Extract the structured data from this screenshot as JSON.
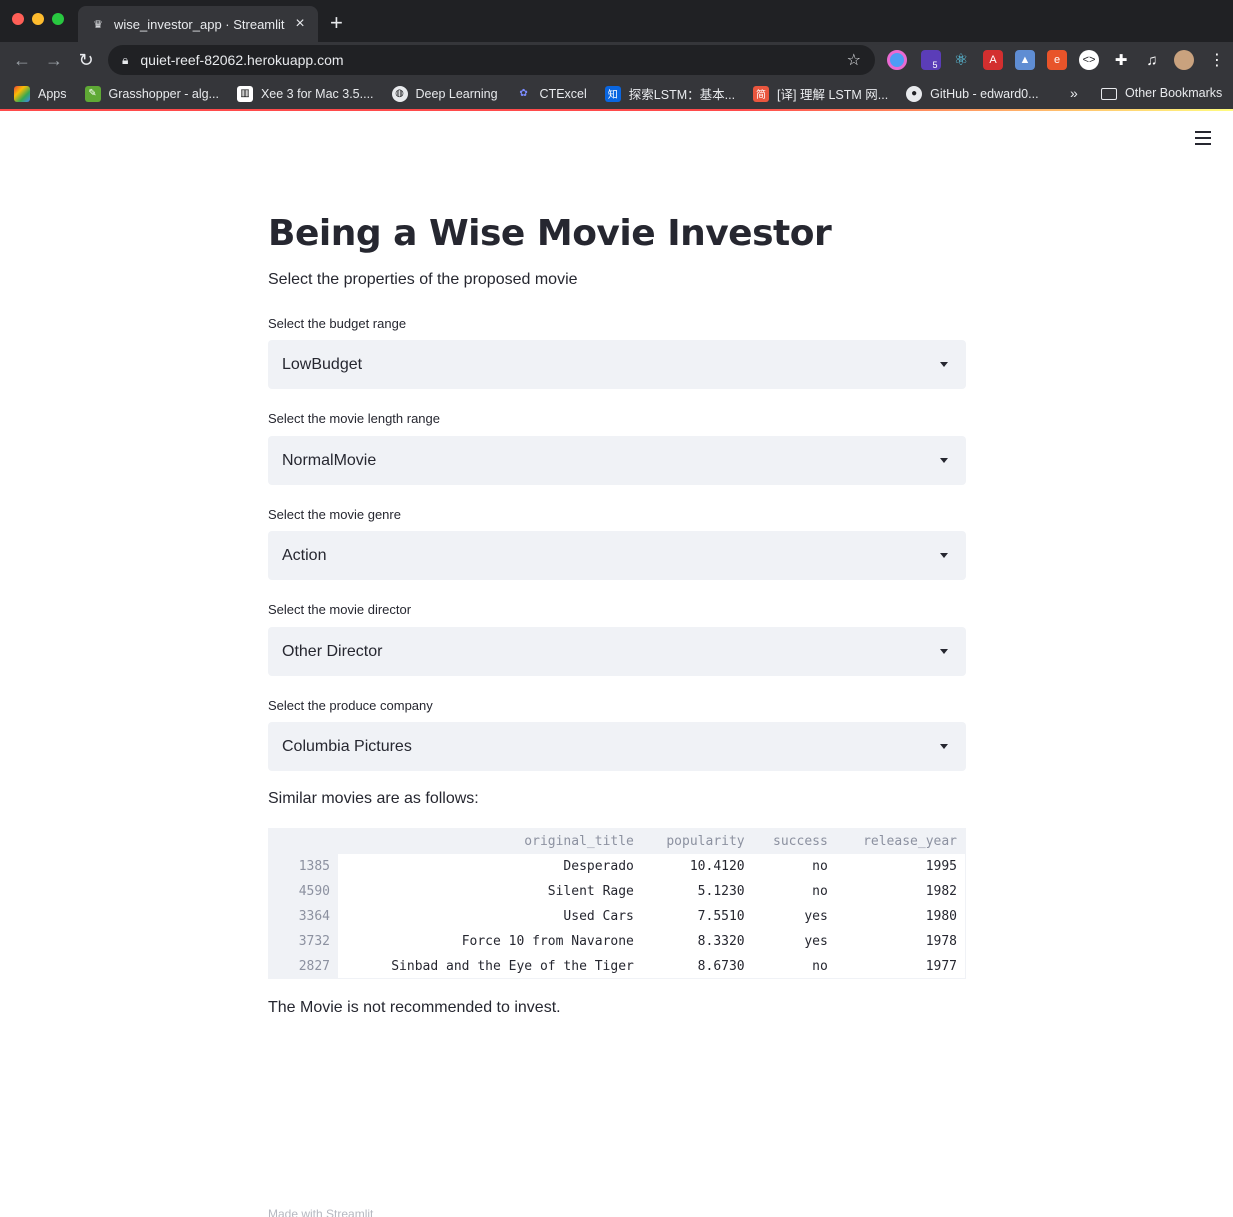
{
  "browser": {
    "tab_title": "wise_investor_app · Streamlit",
    "url": "quiet-reef-82062.herokuapp.com",
    "bookmarks": [
      {
        "label": "Apps",
        "icon": "apps-grid-icon"
      },
      {
        "label": "Grasshopper - alg...",
        "icon": "grasshopper-icon"
      },
      {
        "label": "Xee 3 for Mac 3.5....",
        "icon": "xee-icon"
      },
      {
        "label": "Deep Learning",
        "icon": "globe-icon"
      },
      {
        "label": "CTExcel",
        "icon": "ctexcel-icon"
      },
      {
        "label": "探索LSTM：基本...",
        "icon": "zhihu-icon"
      },
      {
        "label": "[译] 理解 LSTM 网...",
        "icon": "jianshu-icon"
      },
      {
        "label": "GitHub - edward0...",
        "icon": "github-icon"
      }
    ],
    "bookmarks_more": "»",
    "other_bookmarks": "Other Bookmarks",
    "extension_badge": "5"
  },
  "app": {
    "title": "Being a Wise Movie Investor",
    "subtitle": "Select the properties of the proposed movie",
    "fields": [
      {
        "label": "Select the budget range",
        "value": "LowBudget"
      },
      {
        "label": "Select the movie length range",
        "value": "NormalMovie"
      },
      {
        "label": "Select the movie genre",
        "value": "Action"
      },
      {
        "label": "Select the movie director",
        "value": "Other Director"
      },
      {
        "label": "Select the produce company",
        "value": "Columbia Pictures"
      }
    ],
    "similar_heading": "Similar movies are as follows:",
    "table": {
      "columns": [
        "original_title",
        "popularity",
        "success",
        "release_year"
      ],
      "rows": [
        {
          "index": "1385",
          "original_title": "Desperado",
          "popularity": "10.4120",
          "success": "no",
          "release_year": "1995"
        },
        {
          "index": "4590",
          "original_title": "Silent Rage",
          "popularity": "5.1230",
          "success": "no",
          "release_year": "1982"
        },
        {
          "index": "3364",
          "original_title": "Used Cars",
          "popularity": "7.5510",
          "success": "yes",
          "release_year": "1980"
        },
        {
          "index": "3732",
          "original_title": "Force 10 from Navarone",
          "popularity": "8.3320",
          "success": "yes",
          "release_year": "1978"
        },
        {
          "index": "2827",
          "original_title": "Sinbad and the Eye of the Tiger",
          "popularity": "8.6730",
          "success": "no",
          "release_year": "1977"
        }
      ]
    },
    "result": "The Movie is not recommended to invest.",
    "footer": "Made with Streamlit"
  }
}
